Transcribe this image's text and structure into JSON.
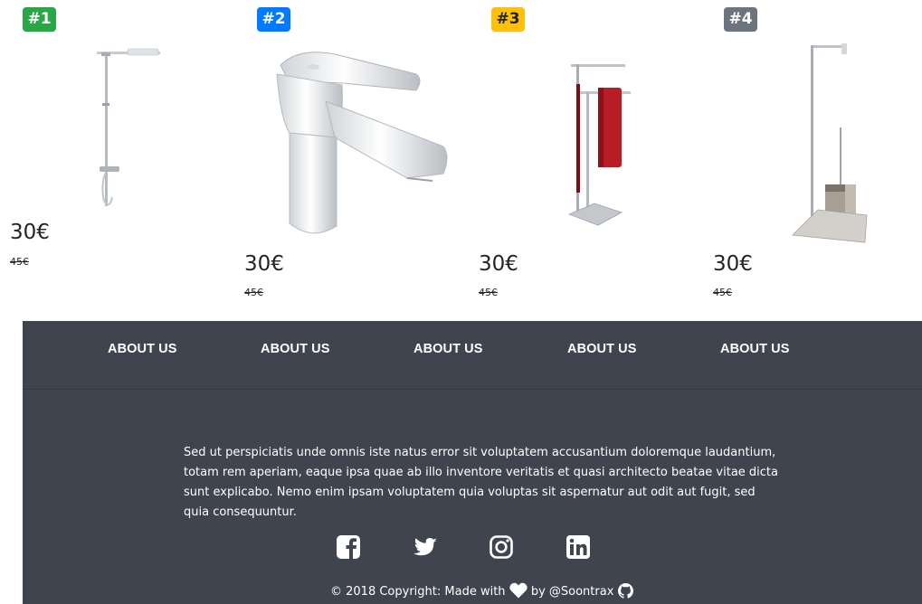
{
  "products": [
    {
      "badge": "#1",
      "badge_color": "#28a745",
      "price": "30€",
      "old_price": "45€",
      "image": "shower-column-icon"
    },
    {
      "badge": "#2",
      "badge_color": "#007bff",
      "price": "30€",
      "old_price": "45€",
      "image": "basin-faucet-icon"
    },
    {
      "badge": "#3",
      "badge_color": "#ffc107",
      "price": "30€",
      "old_price": "45€",
      "image": "towel-stand-icon"
    },
    {
      "badge": "#4",
      "badge_color": "#6c757d",
      "price": "30€",
      "old_price": "45€",
      "image": "toilet-brush-stand-icon"
    }
  ],
  "footer": {
    "background": "#40444f",
    "nav": [
      "ABOUT US",
      "ABOUT US",
      "ABOUT US",
      "ABOUT US",
      "ABOUT US"
    ],
    "description": "Sed ut perspiciatis unde omnis iste natus error sit voluptatem accusantium doloremque laudantium, totam rem aperiam, eaque ipsa quae ab illo inventore veritatis et quasi architecto beatae vitae dicta sunt explicabo. Nemo enim ipsam voluptatem quia voluptas sit aspernatur aut odit aut fugit, sed quia consequuntur.",
    "socials": [
      "facebook-icon",
      "twitter-icon",
      "instagram-icon",
      "linkedin-icon"
    ],
    "copyright_prefix": "© 2018 Copyright: Made with",
    "copyright_suffix": "by @Soontrax",
    "copyright_icons": [
      "heart-icon",
      "github-icon"
    ]
  }
}
